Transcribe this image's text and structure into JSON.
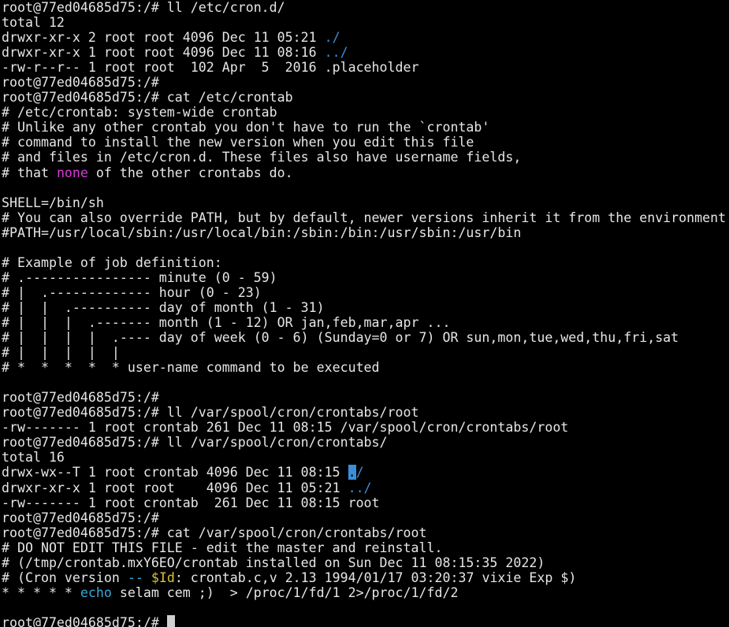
{
  "terminal": {
    "prompt": "root@77ed04685d75:/# ",
    "colors": {
      "background": "#000000",
      "foreground": "#e6e6e6",
      "directory": "#3a8fd8",
      "keyword": "#d93bd9",
      "builtin": "#3aa8d8",
      "variable": "#d9c23a",
      "cursor": "#d0d0d0"
    },
    "lines": [
      [
        {
          "t": "root@77ed04685d75:/# ll /etc/cron.d/"
        }
      ],
      [
        {
          "t": "total 12"
        }
      ],
      [
        {
          "t": "drwxr-xr-x 2 root root 4096 Dec 11 05:21 "
        },
        {
          "t": "./",
          "c": "dir"
        }
      ],
      [
        {
          "t": "drwxr-xr-x 1 root root 4096 Dec 11 08:16 "
        },
        {
          "t": "../",
          "c": "dir"
        }
      ],
      [
        {
          "t": "-rw-r--r-- 1 root root  102 Apr  5  2016 .placeholder"
        }
      ],
      [
        {
          "t": "root@77ed04685d75:/#"
        }
      ],
      [
        {
          "t": "root@77ed04685d75:/# cat /etc/crontab"
        }
      ],
      [
        {
          "t": "# /etc/crontab: system-wide crontab"
        }
      ],
      [
        {
          "t": "# Unlike any other crontab you don't have to run the `crontab'"
        }
      ],
      [
        {
          "t": "# command to install the new version when you edit this file"
        }
      ],
      [
        {
          "t": "# and files in /etc/cron.d. These files also have username fields,"
        }
      ],
      [
        {
          "t": "# that "
        },
        {
          "t": "none",
          "c": "kw"
        },
        {
          "t": " of the other crontabs do."
        }
      ],
      [
        {
          "t": ""
        }
      ],
      [
        {
          "t": "SHELL=/bin/sh"
        }
      ],
      [
        {
          "t": "# You can also override PATH, but by default, newer versions inherit it from the environment"
        }
      ],
      [
        {
          "t": "#PATH=/usr/local/sbin:/usr/local/bin:/sbin:/bin:/usr/sbin:/usr/bin"
        }
      ],
      [
        {
          "t": ""
        }
      ],
      [
        {
          "t": "# Example of job definition:"
        }
      ],
      [
        {
          "t": "# .---------------- minute (0 - 59)"
        }
      ],
      [
        {
          "t": "# |  .------------- hour (0 - 23)"
        }
      ],
      [
        {
          "t": "# |  |  .---------- day of month (1 - 31)"
        }
      ],
      [
        {
          "t": "# |  |  |  .------- month (1 - 12) OR jan,feb,mar,apr ..."
        }
      ],
      [
        {
          "t": "# |  |  |  |  .---- day of week (0 - 6) (Sunday=0 or 7) OR sun,mon,tue,wed,thu,fri,sat"
        }
      ],
      [
        {
          "t": "# |  |  |  |  |"
        }
      ],
      [
        {
          "t": "# *  *  *  *  * user-name command to be executed"
        }
      ],
      [
        {
          "t": ""
        }
      ],
      [
        {
          "t": "root@77ed04685d75:/#"
        }
      ],
      [
        {
          "t": "root@77ed04685d75:/# ll /var/spool/cron/crontabs/root"
        }
      ],
      [
        {
          "t": "-rw------- 1 root crontab 261 Dec 11 08:15 /var/spool/cron/crontabs/root"
        }
      ],
      [
        {
          "t": "root@77ed04685d75:/# ll /var/spool/cron/crontabs/"
        }
      ],
      [
        {
          "t": "total 16"
        }
      ],
      [
        {
          "t": "drwx-wx--T 1 root crontab 4096 Dec 11 08:15 "
        },
        {
          "t": ".",
          "c": "hl"
        },
        {
          "t": "/",
          "c": "dir"
        }
      ],
      [
        {
          "t": "drwxr-xr-x 1 root root    4096 Dec 11 05:21 "
        },
        {
          "t": "../",
          "c": "dir"
        }
      ],
      [
        {
          "t": "-rw------- 1 root crontab  261 Dec 11 08:15 root"
        }
      ],
      [
        {
          "t": "root@77ed04685d75:/#"
        }
      ],
      [
        {
          "t": "root@77ed04685d75:/# cat /var/spool/cron/crontabs/root"
        }
      ],
      [
        {
          "t": "# DO NOT EDIT THIS FILE - edit the master and reinstall."
        }
      ],
      [
        {
          "t": "# (/tmp/crontab.mxY6EO/crontab installed on Sun Dec 11 08:15:35 2022)"
        }
      ],
      [
        {
          "t": "# (Cron version "
        },
        {
          "t": "--",
          "c": "cyan"
        },
        {
          "t": " "
        },
        {
          "t": "$Id",
          "c": "var"
        },
        {
          "t": ": crontab.c,v 2.13 1994/01/17 03:20:37 vixie Exp $)"
        }
      ],
      [
        {
          "t": "* * * * * "
        },
        {
          "t": "echo",
          "c": "cyan"
        },
        {
          "t": " selam cem ;)  > /proc/1/fd/1 2>/proc/1/fd/2"
        }
      ],
      [
        {
          "t": ""
        }
      ],
      [
        {
          "t": "root@77ed04685d75:/# "
        },
        {
          "c": "cursor"
        }
      ]
    ]
  }
}
